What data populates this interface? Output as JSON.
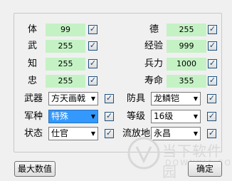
{
  "stats_left": [
    {
      "label": "体",
      "value": "99",
      "checked": true
    },
    {
      "label": "武",
      "value": "255",
      "checked": true
    },
    {
      "label": "知",
      "value": "255",
      "checked": true
    },
    {
      "label": "忠",
      "value": "255",
      "checked": true
    }
  ],
  "stats_right": [
    {
      "label": "德",
      "value": "255",
      "checked": true
    },
    {
      "label": "经验",
      "value": "999",
      "checked": true
    },
    {
      "label": "兵力",
      "value": "1000",
      "checked": true
    },
    {
      "label": "寿命",
      "value": "355",
      "checked": true
    }
  ],
  "selects_left": [
    {
      "label": "武器",
      "value": "方天画戟",
      "checked": true
    },
    {
      "label": "军种",
      "value": "特殊",
      "checked": true
    },
    {
      "label": "状态",
      "value": "仕官",
      "checked": true
    }
  ],
  "selects_right": [
    {
      "label": "防具",
      "value": "龙鳞铠",
      "checked": true
    },
    {
      "label": "等级",
      "value": "16级",
      "checked": true
    },
    {
      "label": "流放地",
      "value": "永昌",
      "checked": true
    }
  ],
  "check_mark": "✓",
  "dropdown_arrow": "▼",
  "buttons": {
    "max_values": "最大数值",
    "confirm": "确定"
  },
  "watermark": {
    "text_cn": "当下软件园",
    "text_en": "DOWNXIA.COM"
  },
  "colors": {
    "value_bg": "#c4f2c4",
    "selected_bg": "#3399ff",
    "checkbox_border": "#1c5180"
  }
}
